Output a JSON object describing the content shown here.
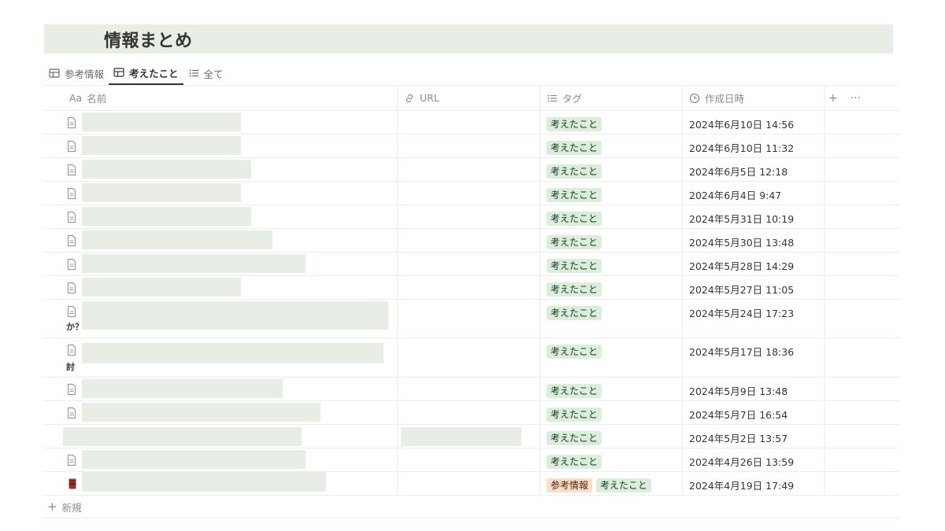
{
  "page": {
    "title": "情報まとめ"
  },
  "tabs": [
    {
      "label": "参考情報",
      "icon": "table-icon",
      "active": false
    },
    {
      "label": "考えたこと",
      "icon": "table-icon",
      "active": true
    },
    {
      "label": "全て",
      "icon": "list-icon",
      "active": false
    }
  ],
  "columns": {
    "name": {
      "label": "名前",
      "prefix": "Aa"
    },
    "url": {
      "label": "URL",
      "icon": "link-icon"
    },
    "tag": {
      "label": "タグ",
      "icon": "list-icon"
    },
    "date": {
      "label": "作成日時",
      "icon": "clock-icon"
    },
    "add": "+",
    "more": "···"
  },
  "rows": [
    {
      "icon": "document-icon",
      "tags": [
        "考えたこと"
      ],
      "created": "2024年6月10日 14:56"
    },
    {
      "icon": "document-icon",
      "tags": [
        "考えたこと"
      ],
      "created": "2024年6月10日 11:32"
    },
    {
      "icon": "document-icon",
      "tags": [
        "考えたこと"
      ],
      "created": "2024年6月5日 12:18"
    },
    {
      "icon": "document-icon",
      "tags": [
        "考えたこと"
      ],
      "created": "2024年6月4日 9:47"
    },
    {
      "icon": "document-icon",
      "tags": [
        "考えたこと"
      ],
      "created": "2024年5月31日 10:19"
    },
    {
      "icon": "document-icon",
      "tags": [
        "考えたこと"
      ],
      "created": "2024年5月30日 13:48"
    },
    {
      "icon": "document-icon",
      "tags": [
        "考えたこと"
      ],
      "created": "2024年5月28日 14:29"
    },
    {
      "icon": "document-icon",
      "tags": [
        "考えたこと"
      ],
      "created": "2024年5月27日 11:05"
    },
    {
      "icon": "document-icon",
      "wrap_text": "か？",
      "tags": [
        "考えたこと"
      ],
      "created": "2024年5月24日 17:23"
    },
    {
      "icon": "document-icon",
      "wrap_text": "討",
      "tags": [
        "考えたこと"
      ],
      "created": "2024年5月17日 18:36"
    },
    {
      "icon": "document-icon",
      "tags": [
        "考えたこと"
      ],
      "created": "2024年5月9日 13:48"
    },
    {
      "icon": "document-icon",
      "tags": [
        "考えたこと"
      ],
      "created": "2024年5月7日 16:54"
    },
    {
      "icon": "none",
      "tags": [
        "考えたこと"
      ],
      "created": "2024年5月2日 13:57"
    },
    {
      "icon": "document-icon",
      "tags": [
        "考えたこと"
      ],
      "created": "2024年4月26日 13:59"
    },
    {
      "icon": "can-icon",
      "tags": [
        "参考情報",
        "考えたこと"
      ],
      "created": "2024年4月19日 17:49"
    }
  ],
  "new_row_label": "新規",
  "colors": {
    "tag_green": "#dbeddb",
    "tag_orange": "#fadec9",
    "redaction": "#e8ede6"
  }
}
